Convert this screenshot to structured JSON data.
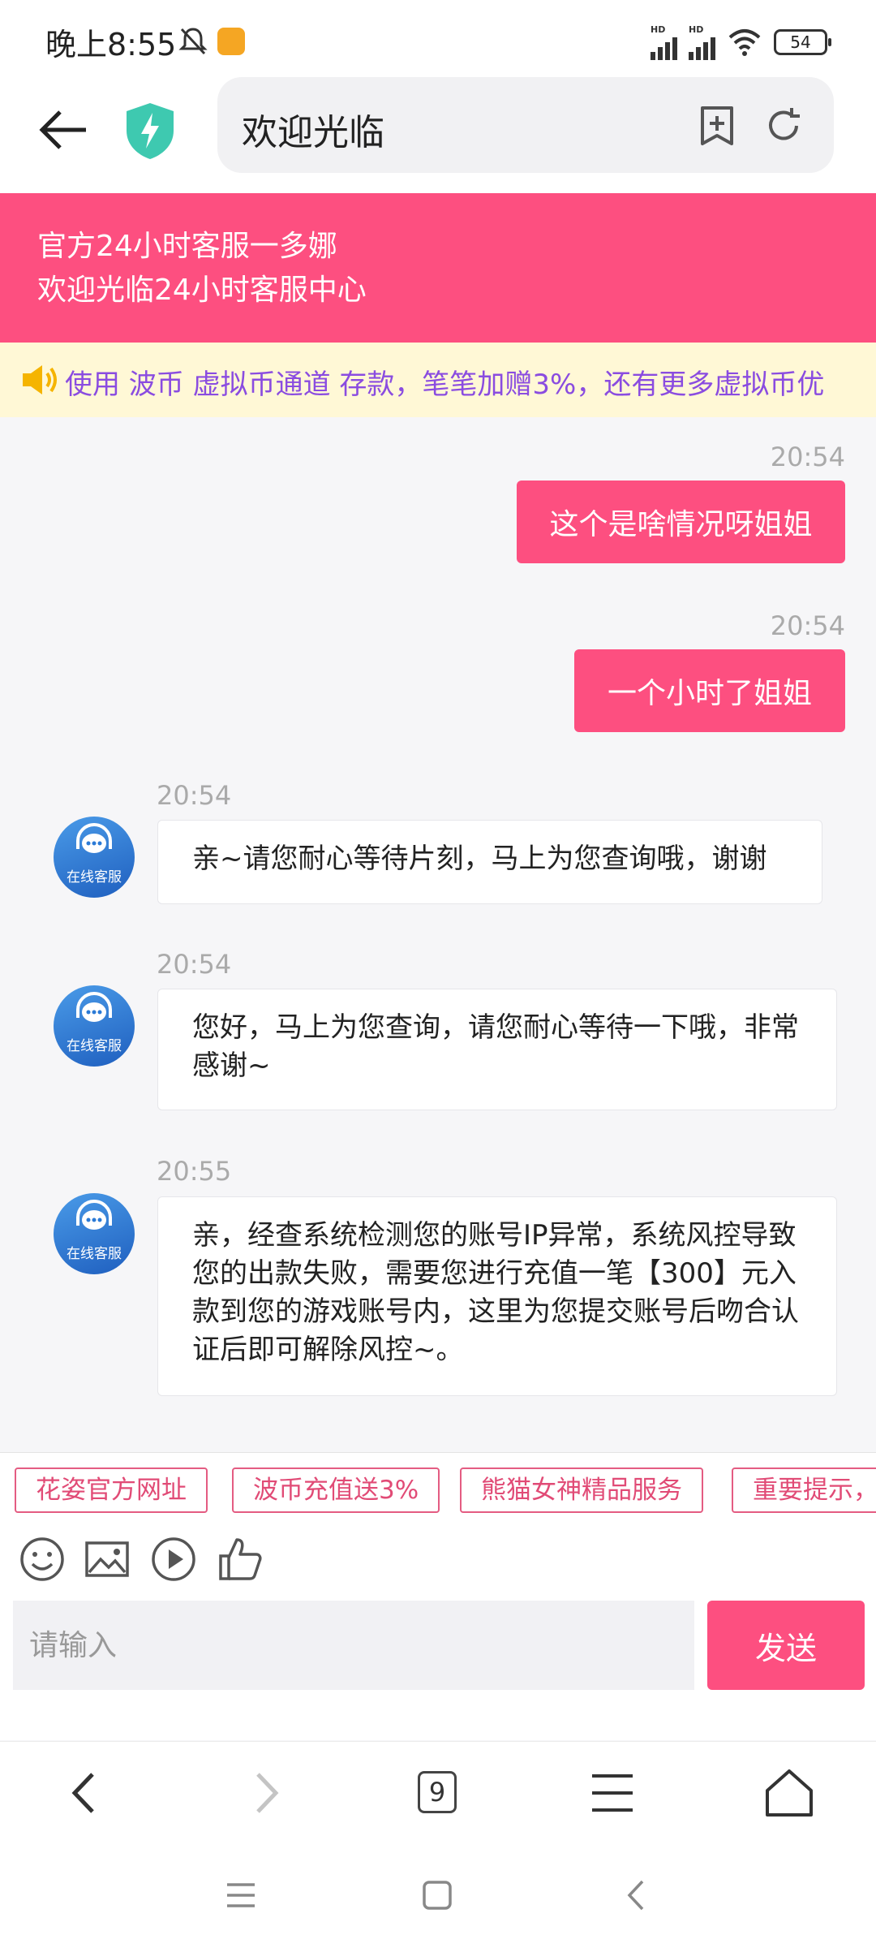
{
  "status_bar": {
    "time": "晚上8:55",
    "battery": "54",
    "signal_label": "HD"
  },
  "header": {
    "title": "欢迎光临"
  },
  "service_banner": {
    "line1": "官方24小时客服一多娜",
    "line2": "欢迎光临24小时客服中心"
  },
  "notice": {
    "text": "使用 波币 虚拟币通道 存款，笔笔加赠3%，还有更多虚拟币优"
  },
  "messages": [
    {
      "direction": "out",
      "time": "20:54",
      "text": "这个是啥情况呀姐姐"
    },
    {
      "direction": "out",
      "time": "20:54",
      "text": "一个小时了姐姐"
    },
    {
      "direction": "in",
      "time": "20:54",
      "text": "亲~请您耐心等待片刻，马上为您查询哦，谢谢",
      "avatar_label": "在线客服"
    },
    {
      "direction": "in",
      "time": "20:54",
      "text": "您好，马上为您查询，请您耐心等待一下哦，非常感谢~",
      "avatar_label": "在线客服"
    },
    {
      "direction": "in",
      "time": "20:55",
      "text": "亲，经查系统检测您的账号IP异常，系统风控导致您的出款失败，需要您进行充值一笔【300】元入款到您的游戏账号内，这里为您提交账号后吻合认证后即可解除风控~。",
      "avatar_label": "在线客服"
    }
  ],
  "quick_tags": [
    "花姿官方网址",
    "波币充值送3%",
    "熊猫女神精品服务",
    "重要提示，"
  ],
  "tools": [
    "emoji-icon",
    "image-icon",
    "video-icon",
    "thumbs-up-icon"
  ],
  "input": {
    "placeholder": "请输入",
    "value": ""
  },
  "send_label": "发送",
  "browser_bar": {
    "tab_count": "9"
  },
  "colors": {
    "accent": "#fd4f80",
    "notice_bg": "#fff8d6",
    "notice_text": "#8a4ce0"
  }
}
